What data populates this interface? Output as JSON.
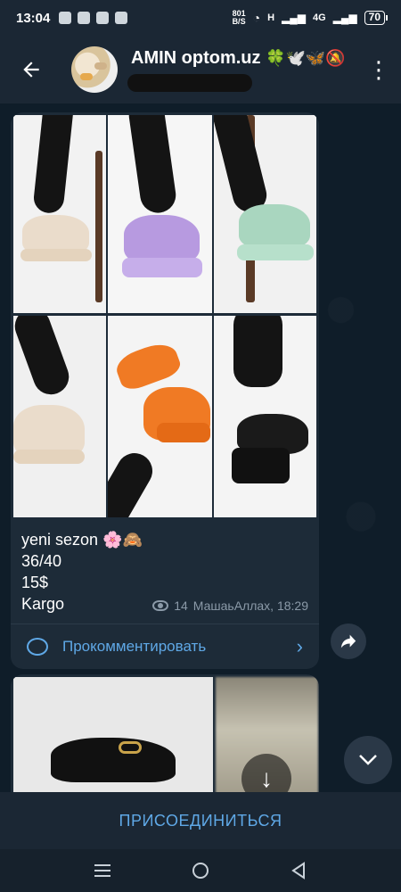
{
  "status_bar": {
    "time": "13:04",
    "speed_value": "801",
    "speed_unit": "B/S",
    "net1": "H",
    "net2": "4G",
    "battery": "70"
  },
  "header": {
    "title": "AMIN optom.uz",
    "title_emojis": "🍀🕊️🦋🔕"
  },
  "post": {
    "text_lines": [
      "yeni sezon 🌸🙈",
      "36/40",
      "15$",
      "Kargo"
    ],
    "views": "14",
    "author_time": "МашаьАллах, 18:29",
    "comment_label": "Прокомментировать"
  },
  "join_label": "ПРИСОЕДИНИТЬСЯ",
  "photos": [
    {
      "shoe_color": "#eadccb"
    },
    {
      "shoe_color": "#b79ae0"
    },
    {
      "shoe_color": "#a9d6bf"
    },
    {
      "shoe_color": "#eadccb"
    },
    {
      "shoe_color": "#f07a24"
    },
    {
      "shoe_color": "#1a1a1a"
    }
  ],
  "colors": {
    "accent": "#5fa8e6",
    "bubble": "#1d2b38",
    "header": "#1b2734"
  }
}
